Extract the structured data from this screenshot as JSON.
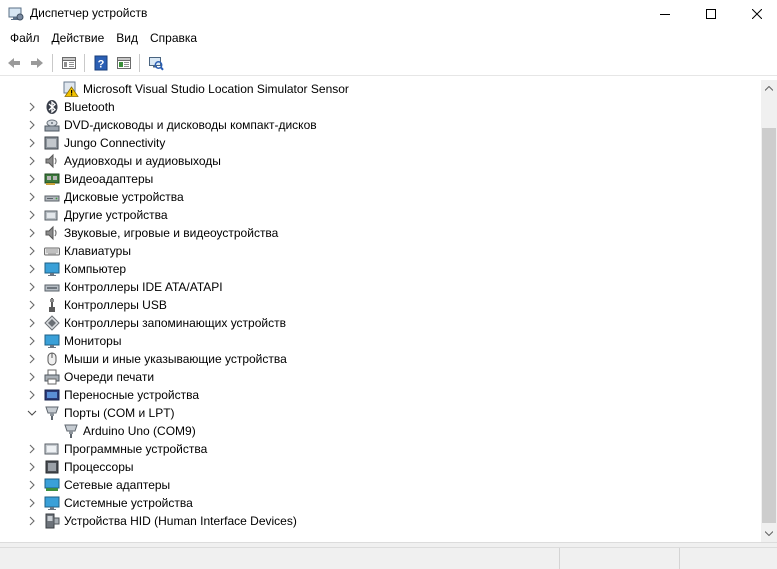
{
  "window": {
    "title": "Диспетчер устройств",
    "icon": "device-manager-icon"
  },
  "menu": [
    "Файл",
    "Действие",
    "Вид",
    "Справка"
  ],
  "toolbar": {
    "buttons": [
      "back-icon",
      "forward-icon",
      "properties-icon",
      "help-icon",
      "update-driver-icon",
      "scan-hardware-icon"
    ]
  },
  "tree": {
    "items": [
      {
        "label": "Microsoft Visual Studio Location Simulator Sensor",
        "level": 1,
        "icon": "warning-device-icon"
      },
      {
        "label": "Bluetooth",
        "level": 0,
        "expanded": false,
        "icon": "bluetooth-icon"
      },
      {
        "label": "DVD-дисководы и дисководы компакт-дисков",
        "level": 0,
        "expanded": false,
        "icon": "dvd-drive-icon"
      },
      {
        "label": "Jungo Connectivity",
        "level": 0,
        "expanded": false,
        "icon": "jungo-device-icon"
      },
      {
        "label": "Аудиовходы и аудиовыходы",
        "level": 0,
        "expanded": false,
        "icon": "speaker-icon"
      },
      {
        "label": "Видеоадаптеры",
        "level": 0,
        "expanded": false,
        "icon": "display-adapter-icon"
      },
      {
        "label": "Дисковые устройства",
        "level": 0,
        "expanded": false,
        "icon": "disk-drive-icon"
      },
      {
        "label": "Другие устройства",
        "level": 0,
        "expanded": false,
        "icon": "other-devices-icon"
      },
      {
        "label": "Звуковые, игровые и видеоустройства",
        "level": 0,
        "expanded": false,
        "icon": "sound-icon"
      },
      {
        "label": "Клавиатуры",
        "level": 0,
        "expanded": false,
        "icon": "keyboard-icon"
      },
      {
        "label": "Компьютер",
        "level": 0,
        "expanded": false,
        "icon": "computer-icon"
      },
      {
        "label": "Контроллеры IDE ATA/ATAPI",
        "level": 0,
        "expanded": false,
        "icon": "ide-controller-icon"
      },
      {
        "label": "Контроллеры USB",
        "level": 0,
        "expanded": false,
        "icon": "usb-icon"
      },
      {
        "label": "Контроллеры запоминающих устройств",
        "level": 0,
        "expanded": false,
        "icon": "storage-controller-icon"
      },
      {
        "label": "Мониторы",
        "level": 0,
        "expanded": false,
        "icon": "monitor-icon"
      },
      {
        "label": "Мыши и иные указывающие устройства",
        "level": 0,
        "expanded": false,
        "icon": "mouse-icon"
      },
      {
        "label": "Очереди печати",
        "level": 0,
        "expanded": false,
        "icon": "printer-icon"
      },
      {
        "label": "Переносные устройства",
        "level": 0,
        "expanded": false,
        "icon": "portable-device-icon"
      },
      {
        "label": "Порты (COM и LPT)",
        "level": 0,
        "expanded": true,
        "icon": "port-icon"
      },
      {
        "label": "Arduino Uno (COM9)",
        "level": 1,
        "icon": "port-icon"
      },
      {
        "label": "Программные устройства",
        "level": 0,
        "expanded": false,
        "icon": "software-device-icon"
      },
      {
        "label": "Процессоры",
        "level": 0,
        "expanded": false,
        "icon": "processor-icon"
      },
      {
        "label": "Сетевые адаптеры",
        "level": 0,
        "expanded": false,
        "icon": "network-adapter-icon"
      },
      {
        "label": "Системные устройства",
        "level": 0,
        "expanded": false,
        "icon": "system-device-icon"
      },
      {
        "label": "Устройства HID (Human Interface Devices)",
        "level": 0,
        "expanded": false,
        "icon": "hid-icon"
      }
    ]
  },
  "colors": {
    "scrollbar_track": "#f0f0f0",
    "scrollbar_thumb": "#cdcdcd",
    "status_bar": "#f0f0f0",
    "warning": "#f2c200"
  }
}
